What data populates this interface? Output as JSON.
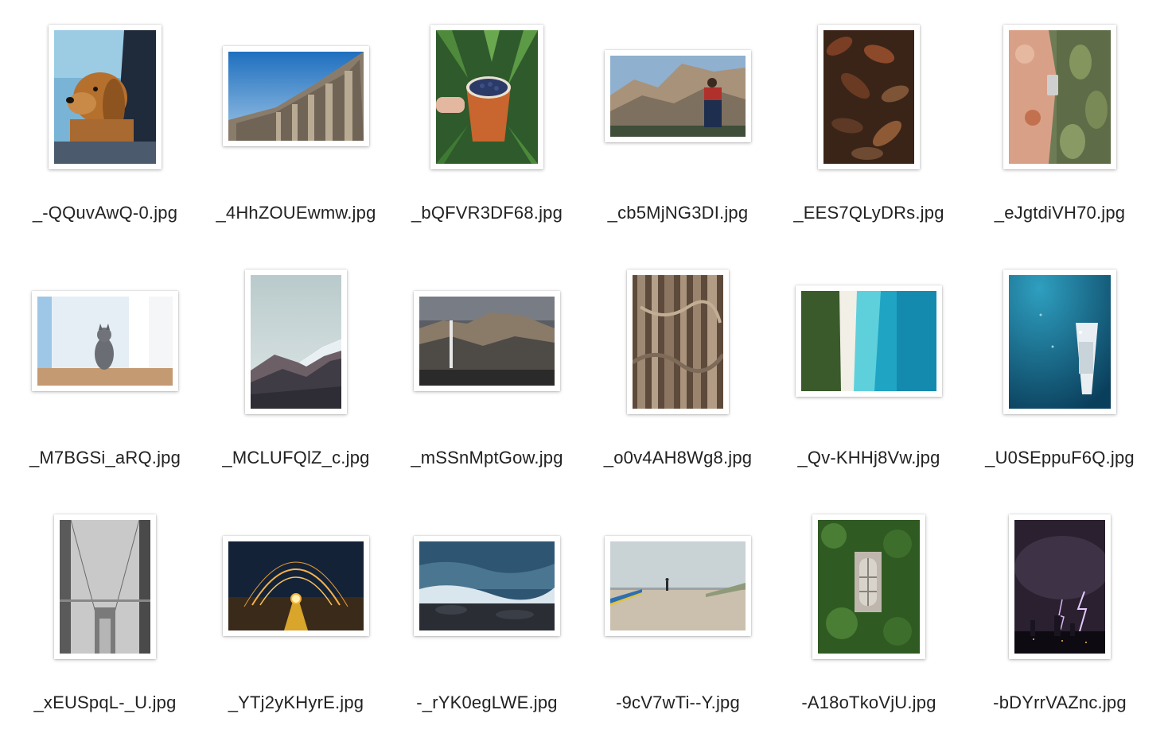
{
  "files": [
    {
      "name": "_-QQuvAwQ-0.jpg",
      "orientation": "portrait",
      "subject": "dog in car window"
    },
    {
      "name": "_4HhZOUEwmw.jpg",
      "orientation": "landscape",
      "subject": "classical colonnade"
    },
    {
      "name": "_bQFVR3DF68.jpg",
      "orientation": "portrait",
      "subject": "cup of blueberries"
    },
    {
      "name": "_cb5MjNG3DI.jpg",
      "orientation": "landscape",
      "subject": "hiker and cliffs"
    },
    {
      "name": "_EES7QLyDRs.jpg",
      "orientation": "portrait",
      "subject": "dry leaves"
    },
    {
      "name": "_eJgtdiVH70.jpg",
      "orientation": "portrait",
      "subject": "phone photo of cactus"
    },
    {
      "name": "_M7BGSi_aRQ.jpg",
      "orientation": "landscape",
      "subject": "gray cat in doorway"
    },
    {
      "name": "_MCLUFQlZ_c.jpg",
      "orientation": "portrait",
      "subject": "snowy mountain ridge"
    },
    {
      "name": "_mSSnMptGow.jpg",
      "orientation": "landscape",
      "subject": "waterfall cliffs"
    },
    {
      "name": "_o0v4AH8Wg8.jpg",
      "orientation": "portrait",
      "subject": "tree roots"
    },
    {
      "name": "_Qv-KHHj8Vw.jpg",
      "orientation": "landscape",
      "subject": "aerial beach"
    },
    {
      "name": "_U0SEppuF6Q.jpg",
      "orientation": "portrait",
      "subject": "boat in ocean"
    },
    {
      "name": "_xEUSpqL-_U.jpg",
      "orientation": "portrait",
      "subject": "bridge in fog"
    },
    {
      "name": "_YTj2yKHyrE.jpg",
      "orientation": "landscape",
      "subject": "steel wool sparks"
    },
    {
      "name": "-_rYK0egLWE.jpg",
      "orientation": "landscape",
      "subject": "ocean waves"
    },
    {
      "name": "-9cV7wTi--Y.jpg",
      "orientation": "landscape",
      "subject": "person on plaza"
    },
    {
      "name": "-A18oTkoVjU.jpg",
      "orientation": "portrait",
      "subject": "ivy covered window"
    },
    {
      "name": "-bDYrrVAZnc.jpg",
      "orientation": "portrait",
      "subject": "lightning over city"
    }
  ]
}
